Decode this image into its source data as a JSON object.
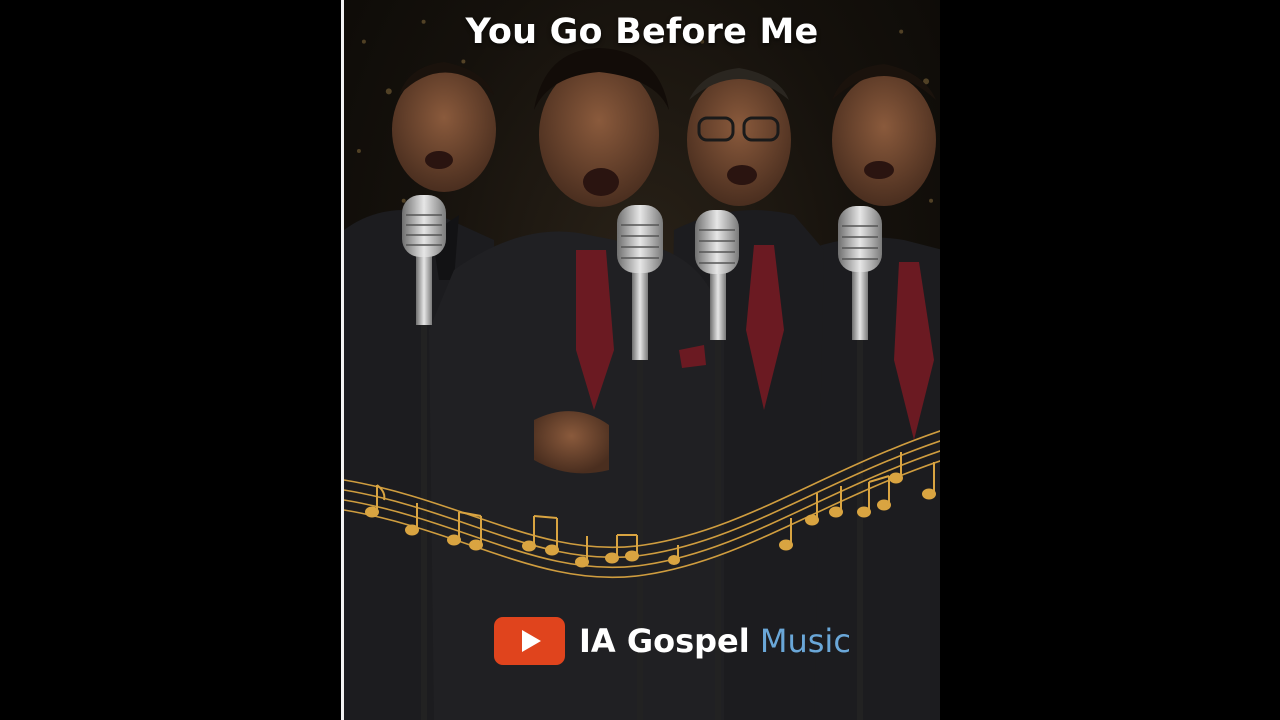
{
  "video": {
    "title": "You Go Before Me"
  },
  "brand": {
    "logo_icon": "youtube-play-icon",
    "name_strong": "IA Gospel",
    "name_light": "Music",
    "colors": {
      "logo_bg": "#e0441d",
      "name_strong": "#ffffff",
      "name_light": "#6aa7d8"
    }
  },
  "scene": {
    "subjects": [
      "singer",
      "singer",
      "singer",
      "singer"
    ],
    "props": [
      "microphone",
      "microphone",
      "microphone",
      "microphone",
      "music-notes-staff"
    ],
    "colors": {
      "background": "#15110c",
      "suit": "#1c1c1f",
      "tie": "#6b1a22",
      "notes": "#d9a441"
    }
  }
}
